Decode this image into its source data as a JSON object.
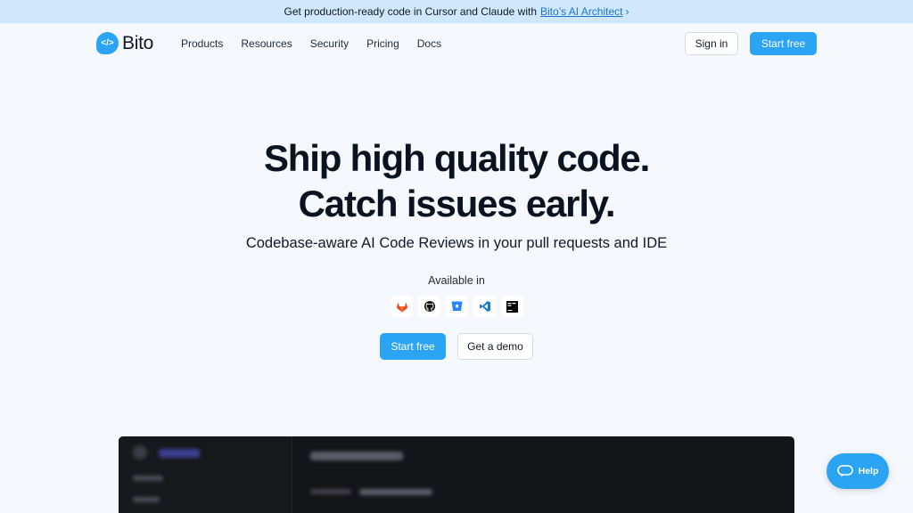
{
  "banner": {
    "text": "Get production-ready code in Cursor and Claude with",
    "link": "Bito’s AI Architect",
    "chevron": "›"
  },
  "nav": {
    "logo_mark": "</>",
    "logo_text": "Bito",
    "items": [
      "Products",
      "Resources",
      "Security",
      "Pricing",
      "Docs"
    ],
    "sign_in": "Sign in",
    "start_free": "Start free"
  },
  "hero": {
    "title_line1": "Ship high quality code.",
    "title_line2": "Catch issues early.",
    "subtitle": "Codebase-aware AI Code Reviews in your pull requests and IDE",
    "available_in": "Available in",
    "platforms": [
      "gitlab-icon",
      "github-icon",
      "bitbucket-icon",
      "vscode-icon",
      "jetbrains-icon"
    ],
    "cta_primary": "Start free",
    "cta_secondary": "Get a demo"
  },
  "help": {
    "label": "Help"
  },
  "colors": {
    "accent": "#2ba4f3",
    "banner": "#cfe8fb",
    "background": "#f5f9fd"
  }
}
